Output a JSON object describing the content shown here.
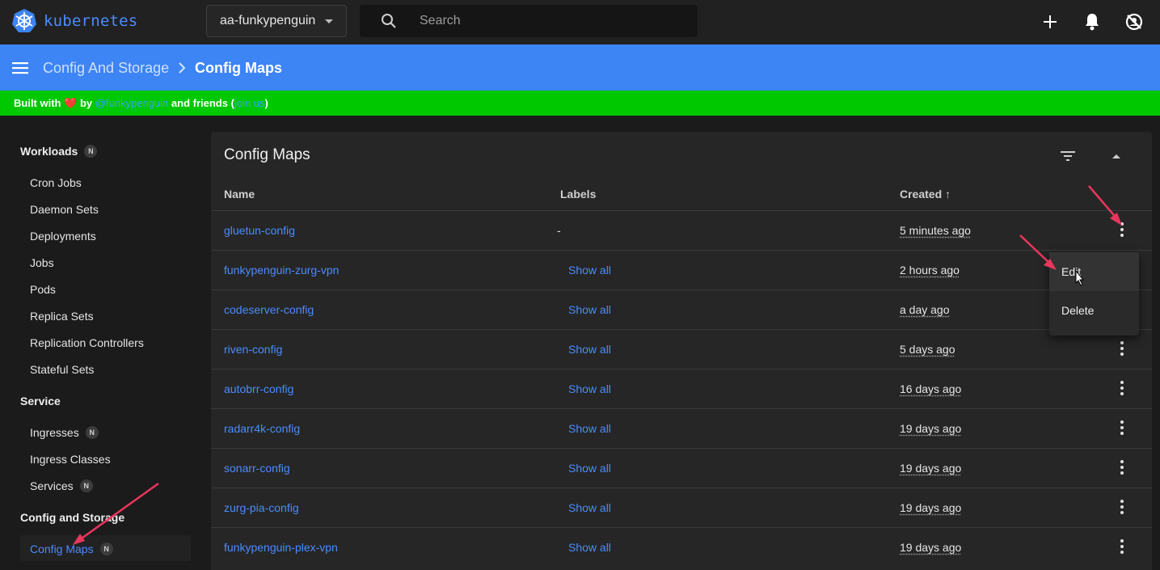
{
  "topbar": {
    "brand": "kubernetes",
    "namespace": "aa-funkypenguin",
    "search_placeholder": "Search"
  },
  "breadcrumb": {
    "parent": "Config And Storage",
    "current": "Config Maps"
  },
  "banner": {
    "prefix": "Built with",
    "heart": "❤️",
    "by": "by",
    "author": "@funkypenguin",
    "middle": "and friends (",
    "join": "join us",
    "suffix": ")"
  },
  "sidebar": {
    "workloads": {
      "label": "Workloads",
      "badge": "N"
    },
    "workload_items": [
      "Cron Jobs",
      "Daemon Sets",
      "Deployments",
      "Jobs",
      "Pods",
      "Replica Sets",
      "Replication Controllers",
      "Stateful Sets"
    ],
    "service": {
      "label": "Service"
    },
    "service_items": [
      {
        "label": "Ingresses",
        "badge": "N"
      },
      {
        "label": "Ingress Classes"
      },
      {
        "label": "Services",
        "badge": "N"
      }
    ],
    "config": {
      "label": "Config and Storage"
    },
    "config_items": [
      {
        "label": "Config Maps",
        "badge": "N",
        "active": true
      }
    ]
  },
  "card": {
    "title": "Config Maps",
    "columns": {
      "name": "Name",
      "labels": "Labels",
      "created": "Created",
      "created_sort": "↑"
    },
    "rows": [
      {
        "name": "gluetun-config",
        "labels": "-",
        "created": "5 minutes ago"
      },
      {
        "name": "funkypenguin-zurg-vpn",
        "labels": "Show all",
        "created": "2 hours ago"
      },
      {
        "name": "codeserver-config",
        "labels": "Show all",
        "created": "a day ago"
      },
      {
        "name": "riven-config",
        "labels": "Show all",
        "created": "5 days ago"
      },
      {
        "name": "autobrr-config",
        "labels": "Show all",
        "created": "16 days ago"
      },
      {
        "name": "radarr4k-config",
        "labels": "Show all",
        "created": "19 days ago"
      },
      {
        "name": "sonarr-config",
        "labels": "Show all",
        "created": "19 days ago"
      },
      {
        "name": "zurg-pia-config",
        "labels": "Show all",
        "created": "19 days ago"
      },
      {
        "name": "funkypenguin-plex-vpn",
        "labels": "Show all",
        "created": "19 days ago"
      }
    ]
  },
  "context_menu": {
    "edit": "Edit",
    "delete": "Delete"
  },
  "colors": {
    "accent": "#4a8cff",
    "header": "#3d84f5",
    "banner": "#00c800",
    "annotation": "#e8365d"
  }
}
